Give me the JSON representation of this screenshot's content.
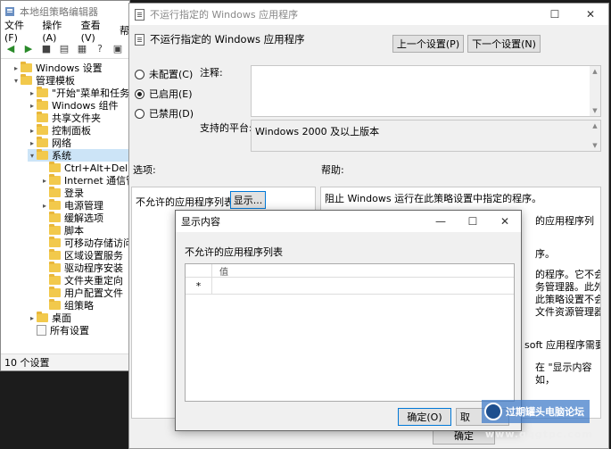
{
  "gpedit": {
    "title": "本地组策略编辑器",
    "menu": [
      "文件(F)",
      "操作(A)",
      "查看(V)",
      "帮"
    ],
    "tree": [
      {
        "label": "Windows 设置"
      },
      {
        "label": "管理模板"
      },
      {
        "label": "\"开始\"菜单和任务栏"
      },
      {
        "label": "Windows 组件"
      },
      {
        "label": "共享文件夹"
      },
      {
        "label": "控制面板"
      },
      {
        "label": "网络"
      },
      {
        "label": "系统"
      },
      {
        "label": "Ctrl+Alt+Del 选项"
      },
      {
        "label": "Internet 通信管理"
      },
      {
        "label": "登录"
      },
      {
        "label": "电源管理"
      },
      {
        "label": "缓解选项"
      },
      {
        "label": "脚本"
      },
      {
        "label": "可移动存储访问"
      },
      {
        "label": "区域设置服务"
      },
      {
        "label": "驱动程序安装"
      },
      {
        "label": "文件夹重定向"
      },
      {
        "label": "用户配置文件"
      },
      {
        "label": "组策略"
      },
      {
        "label": "桌面"
      },
      {
        "label": "所有设置"
      }
    ],
    "status": "10 个设置"
  },
  "policy": {
    "title": "不运行指定的 Windows 应用程序",
    "header": "不运行指定的 Windows 应用程序",
    "prev_button": "上一个设置(P)",
    "next_button": "下一个设置(N)",
    "radio_not_configured": "未配置(C)",
    "radio_enabled": "已启用(E)",
    "radio_disabled": "已禁用(D)",
    "comment_label": "注释:",
    "supported_label": "支持的平台:",
    "supported_value": "Windows 2000 及以上版本",
    "options_label": "选项:",
    "help_label": "帮助:",
    "disallowed_label": "不允许的应用程序列表",
    "show_button": "显示...",
    "help_lines": [
      "阻止 Windows 运行在此策略设置中指定的程序。",
      "的应用程序列",
      "序。",
      "的程序。它不会",
      "务管理器。此外",
      "此策略设置不会",
      "文件资源管理器启",
      "soft 应用程序需要",
      "在 \"显示内容",
      "如，"
    ],
    "ok_partial": "确定"
  },
  "show_dialog": {
    "title": "显示内容",
    "list_label": "不允许的应用程序列表",
    "column_header": "值",
    "new_row_marker": "*",
    "ok_button": "确定(O)",
    "cancel_partial": "取"
  },
  "watermark": {
    "text": "过期罐头电脑论坛",
    "url": "www.gqgtpc.com"
  }
}
